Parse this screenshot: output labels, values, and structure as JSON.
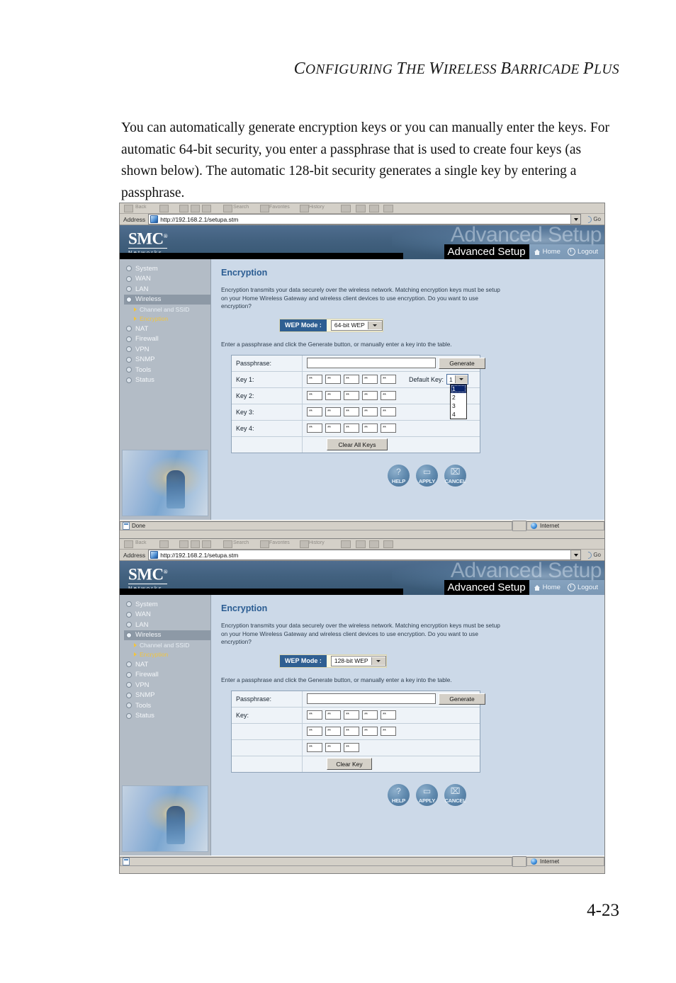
{
  "manual": {
    "running_head": "CONFIGURING THE WIRELESS BARRICADE PLUS",
    "body_paragraph": "You can automatically generate encryption keys or you can manually enter the keys. For automatic 64-bit security, you enter a passphrase that is used to create four keys (as shown below). The automatic 128-bit security generates a single key by entering a passphrase.",
    "page_number": "4-23"
  },
  "browser": {
    "address_label": "Address",
    "url": "http://192.168.2.1/setupa.stm",
    "go_label": "Go",
    "toolbar_items": [
      "Back",
      "Forward",
      "Stop",
      "Refresh",
      "Home",
      "Search",
      "Favorites",
      "History",
      "Mail",
      "Print",
      "Edit",
      "Discuss"
    ],
    "status_done": "Done",
    "status_empty": "",
    "zone": "Internet"
  },
  "ui": {
    "brand": "SMC",
    "brand_reg": "®",
    "brand_sub": "Networks",
    "watermark": "Advanced Setup",
    "header_label": "Advanced Setup",
    "home_link": "Home",
    "logout_link": "Logout",
    "nav": [
      {
        "label": "System",
        "selected": false
      },
      {
        "label": "WAN",
        "selected": false
      },
      {
        "label": "LAN",
        "selected": false
      },
      {
        "label": "Wireless",
        "selected": true
      }
    ],
    "nav_sub": [
      {
        "label": "Channel and SSID",
        "active": false
      },
      {
        "label": "Encryption",
        "active": true
      }
    ],
    "nav_rest": [
      {
        "label": "NAT"
      },
      {
        "label": "Firewall"
      },
      {
        "label": "VPN"
      },
      {
        "label": "SNMP"
      },
      {
        "label": "Tools"
      },
      {
        "label": "Status"
      }
    ],
    "section_title": "Encryption",
    "description": "Encryption transmits your data securely over the wireless network. Matching encryption keys must be setup on your Home Wireless Gateway and wireless client devices to use encryption. Do you want to use encryption?",
    "wep_mode_label": "WEP Mode :",
    "passphrase_instruction": "Enter a passphrase and click the Generate button, or manually enter a key into the table.",
    "passphrase_label": "Passphrase:",
    "passphrase_value": "",
    "generate_button": "Generate",
    "masked_value": "**",
    "actions": [
      {
        "label": "HELP",
        "glyph": "?"
      },
      {
        "label": "APPLY",
        "glyph": "▭"
      },
      {
        "label": "CANCEL",
        "glyph": "⌧"
      }
    ]
  },
  "screen_64": {
    "wep_mode_value": "64-bit WEP",
    "key_rows": [
      {
        "label": "Key 1:",
        "fields": 5
      },
      {
        "label": "Key 2:",
        "fields": 5
      },
      {
        "label": "Key 3:",
        "fields": 5
      },
      {
        "label": "Key 4:",
        "fields": 5
      }
    ],
    "default_key_label": "Default Key:",
    "default_key_value": "1",
    "default_key_options": [
      "1",
      "2",
      "3",
      "4"
    ],
    "clear_button": "Clear All Keys"
  },
  "screen_128": {
    "wep_mode_value": "128-bit WEP",
    "key_label": "Key:",
    "key_row_fields": [
      5,
      5,
      3
    ],
    "clear_button": "Clear Key"
  }
}
